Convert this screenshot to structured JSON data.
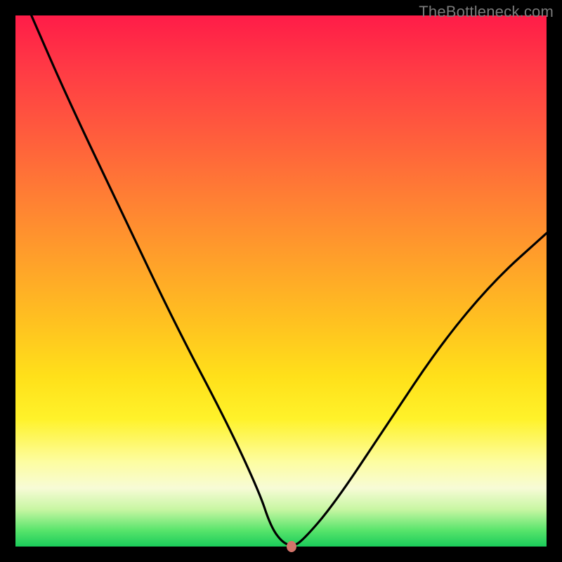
{
  "watermark": "TheBottleneck.com",
  "chart_data": {
    "type": "line",
    "title": "",
    "xlabel": "",
    "ylabel": "",
    "xlim": [
      0,
      100
    ],
    "ylim": [
      0,
      100
    ],
    "grid": false,
    "legend": false,
    "series": [
      {
        "name": "bottleneck-curve",
        "x": [
          3,
          10,
          20,
          30,
          40,
          46,
          48,
          50,
          52,
          54,
          60,
          70,
          80,
          90,
          100
        ],
        "y": [
          100,
          84,
          63,
          42,
          23,
          10,
          4,
          1,
          0,
          1,
          8,
          23,
          38,
          50,
          59
        ]
      }
    ],
    "minimum_point": {
      "x": 52,
      "y": 0
    },
    "marker_color": "#d2746a",
    "curve_color": "#000000",
    "gradient_stops": [
      {
        "pos": 0,
        "color": "#ff1c48"
      },
      {
        "pos": 50,
        "color": "#ffb020"
      },
      {
        "pos": 80,
        "color": "#fff24a"
      },
      {
        "pos": 100,
        "color": "#1acb5a"
      }
    ]
  }
}
